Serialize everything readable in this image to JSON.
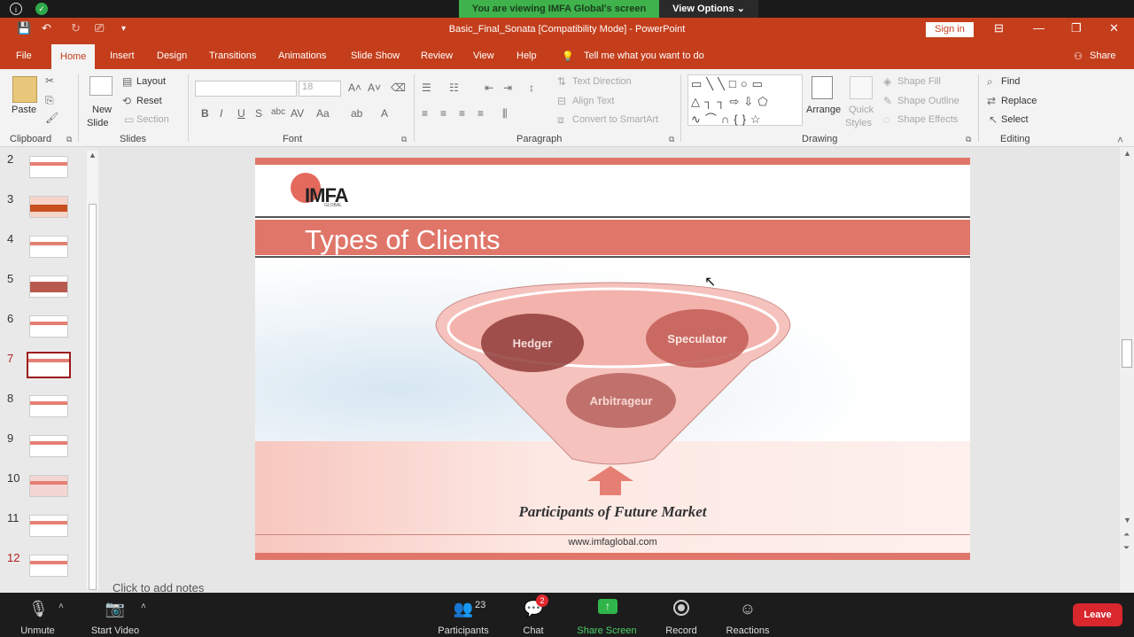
{
  "zoom_top": {
    "viewing_banner": "You are viewing IMFA Global's screen",
    "view_options": "View Options"
  },
  "titlebar": {
    "title": "Basic_Final_Sonata [Compatibility Mode]  -  PowerPoint",
    "sign_in": "Sign in"
  },
  "tabs": [
    "File",
    "Home",
    "Insert",
    "Design",
    "Transitions",
    "Animations",
    "Slide Show",
    "Review",
    "View",
    "Help"
  ],
  "tell_me": "Tell me what you want to do",
  "share": "Share",
  "ribbon": {
    "clipboard": {
      "paste": "Paste",
      "label": "Clipboard"
    },
    "slides": {
      "new_slide_1": "New",
      "new_slide_2": "Slide",
      "layout": "Layout",
      "reset": "Reset",
      "section": "Section",
      "label": "Slides"
    },
    "font": {
      "size": "18",
      "label": "Font"
    },
    "paragraph": {
      "text_direction": "Text Direction",
      "align_text": "Align Text",
      "convert": "Convert to SmartArt",
      "label": "Paragraph"
    },
    "drawing": {
      "arrange": "Arrange",
      "quick_1": "Quick",
      "quick_2": "Styles",
      "shape_fill": "Shape Fill",
      "shape_outline": "Shape Outline",
      "shape_effects": "Shape Effects",
      "label": "Drawing"
    },
    "editing": {
      "find": "Find",
      "replace": "Replace",
      "select": "Select",
      "label": "Editing"
    }
  },
  "thumbnails": {
    "numbers": [
      "2",
      "3",
      "4",
      "5",
      "6",
      "7",
      "8",
      "9",
      "10",
      "11",
      "12"
    ],
    "selected": "7"
  },
  "slide": {
    "logo": "IMFA",
    "logo_sub": "GLOBAL",
    "title": "Types of Clients",
    "funnel_items": [
      "Hedger",
      "Speculator",
      "Arbitrageur"
    ],
    "caption": "Participants of Future Market",
    "footer": "www.imfaglobal.com"
  },
  "notes_placeholder": "Click to add notes",
  "zoom_bottom": {
    "unmute": "Unmute",
    "start_video": "Start Video",
    "participants": "Participants",
    "participant_count": "23",
    "chat": "Chat",
    "chat_badge": "2",
    "share_screen": "Share Screen",
    "record": "Record",
    "reactions": "Reactions",
    "leave": "Leave"
  },
  "colors": {
    "ppt_accent": "#c43e1c",
    "zoom_green": "#3fb24b",
    "leave_red": "#d9272e",
    "slide_band": "#e0766a"
  }
}
